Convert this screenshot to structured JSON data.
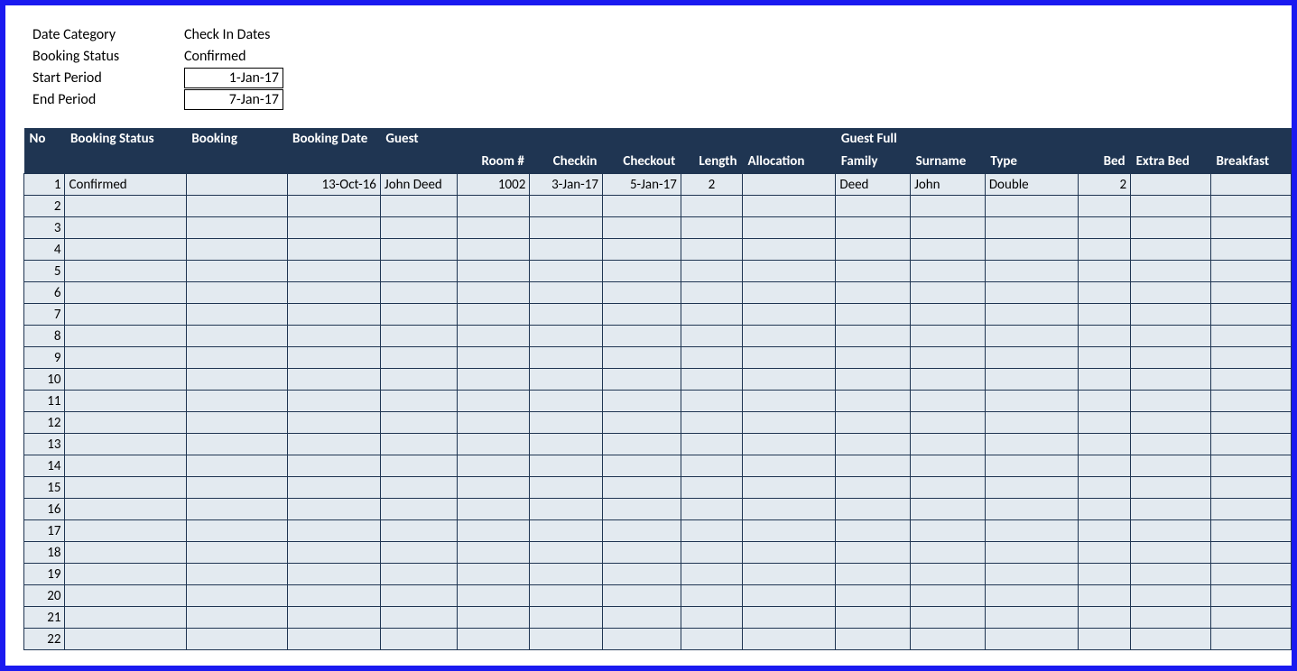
{
  "filters": {
    "date_category_label": "Date Category",
    "date_category_value": "Check In Dates",
    "booking_status_label": "Booking Status",
    "booking_status_value": "Confirmed",
    "start_period_label": "Start Period",
    "start_period_value": "1-Jan-17",
    "end_period_label": "End Period",
    "end_period_value": "7-Jan-17"
  },
  "headers": {
    "row1": {
      "no": "No",
      "booking_status": "Booking Status",
      "booking": "Booking",
      "booking_date": "Booking Date",
      "guest": "Guest",
      "guest_full": "Guest Full"
    },
    "row2": {
      "room": "Room #",
      "checkin": "Checkin",
      "checkout": "Checkout",
      "length": "Length",
      "allocation": "Allocation",
      "family": "Family",
      "surname": "Surname",
      "type": "Type",
      "bed": "Bed",
      "extra_bed": "Extra Bed",
      "breakfast": "Breakfast"
    }
  },
  "rows": [
    {
      "no": "1",
      "booking_status": "Confirmed",
      "booking": "",
      "booking_date": "13-Oct-16",
      "guest": "John Deed",
      "room": "1002",
      "checkin": "3-Jan-17",
      "checkout": "5-Jan-17",
      "length": "2",
      "allocation": "",
      "family": "Deed",
      "surname": "John",
      "type": "Double",
      "bed": "2",
      "extra_bed": "",
      "breakfast": ""
    },
    {
      "no": "2"
    },
    {
      "no": "3"
    },
    {
      "no": "4"
    },
    {
      "no": "5"
    },
    {
      "no": "6"
    },
    {
      "no": "7"
    },
    {
      "no": "8"
    },
    {
      "no": "9"
    },
    {
      "no": "10"
    },
    {
      "no": "11"
    },
    {
      "no": "12"
    },
    {
      "no": "13"
    },
    {
      "no": "14"
    },
    {
      "no": "15"
    },
    {
      "no": "16"
    },
    {
      "no": "17"
    },
    {
      "no": "18"
    },
    {
      "no": "19"
    },
    {
      "no": "20"
    },
    {
      "no": "21"
    },
    {
      "no": "22"
    }
  ]
}
